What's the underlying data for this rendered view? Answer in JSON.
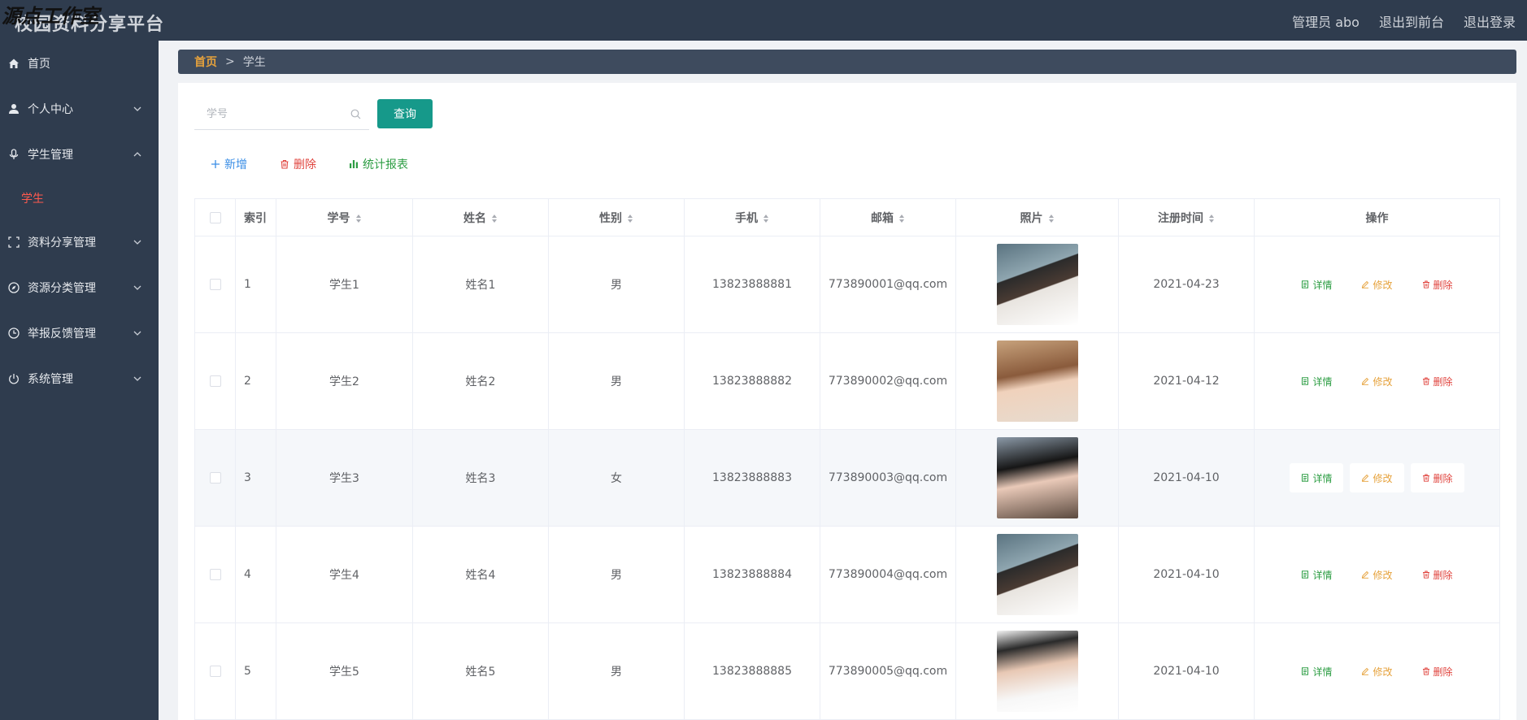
{
  "header": {
    "title": "校园资料分享平台",
    "watermark": "源点工作室",
    "user": "管理员 abo",
    "front": "退出到前台",
    "logout": "退出登录"
  },
  "sidebar": {
    "items": [
      {
        "label": "首页",
        "icon": "home-icon"
      },
      {
        "label": "个人中心",
        "icon": "user-icon"
      },
      {
        "label": "学生管理",
        "icon": "mic-icon"
      },
      {
        "label": "资料分享管理",
        "icon": "frame-icon"
      },
      {
        "label": "资源分类管理",
        "icon": "compass-icon"
      },
      {
        "label": "举报反馈管理",
        "icon": "clock-icon"
      },
      {
        "label": "系统管理",
        "icon": "power-icon"
      }
    ],
    "sub_active": "学生"
  },
  "breadcrumb": {
    "home": "首页",
    "sep": ">",
    "current": "学生"
  },
  "search": {
    "placeholder": "学号",
    "button": "查询"
  },
  "actions": {
    "add": "新增",
    "delete": "删除",
    "stats": "统计报表"
  },
  "table": {
    "headers": [
      "索引",
      "学号",
      "姓名",
      "性别",
      "手机",
      "邮箱",
      "照片",
      "注册时间",
      "操作"
    ],
    "ops": {
      "detail": "详情",
      "edit": "修改",
      "remove": "删除"
    },
    "rows": [
      {
        "index": "1",
        "sid": "学生1",
        "name": "姓名1",
        "gender": "男",
        "phone": "13823888881",
        "email": "773890001@qq.com",
        "date": "2021-04-23"
      },
      {
        "index": "2",
        "sid": "学生2",
        "name": "姓名2",
        "gender": "男",
        "phone": "13823888882",
        "email": "773890002@qq.com",
        "date": "2021-04-12"
      },
      {
        "index": "3",
        "sid": "学生3",
        "name": "姓名3",
        "gender": "女",
        "phone": "13823888883",
        "email": "773890003@qq.com",
        "date": "2021-04-10"
      },
      {
        "index": "4",
        "sid": "学生4",
        "name": "姓名4",
        "gender": "男",
        "phone": "13823888884",
        "email": "773890004@qq.com",
        "date": "2021-04-10"
      },
      {
        "index": "5",
        "sid": "学生5",
        "name": "姓名5",
        "gender": "男",
        "phone": "13823888885",
        "email": "773890005@qq.com",
        "date": "2021-04-10"
      }
    ]
  }
}
